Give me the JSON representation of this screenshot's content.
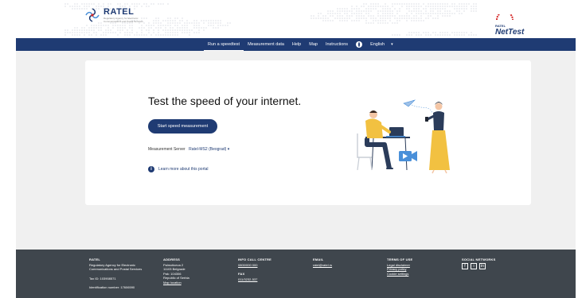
{
  "header": {
    "logo_left": "RATEL",
    "logo_left_sub": "Regulatory Agency for Electronic Communications and Postal Services",
    "logo_right_small": "RATEL",
    "logo_right_big": "NetTest"
  },
  "nav": {
    "items": [
      "Run a speedtest",
      "Measurement data",
      "Help",
      "Map",
      "Instructions"
    ],
    "active_index": 0,
    "language": "English"
  },
  "main": {
    "headline": "Test the speed of your internet.",
    "start_button": "Start speed measurement",
    "server_label": "Measurement Server",
    "server_value": "Ratel-MS2 (Beograd)",
    "learn_more": "Learn more about this portal"
  },
  "footer": {
    "ratel_title": "RATEL",
    "ratel_line1": "Regulatory Agency for Electronic",
    "ratel_line2": "Communications and Postal Services",
    "tax_id": "Tax ID: 103908571",
    "identification": "Identification number: 17606590",
    "address_title": "ADDRESS",
    "address_line1": "Palmoticeva 2",
    "address_line2": "11103 Belgrade",
    "address_line3": "Pak: 104306",
    "address_line4": "Republic of Serbia",
    "address_link": "Map location",
    "info_title": "INFO CALL CENTRE",
    "info_phone": "0800/000 000",
    "fax_title": "FAX",
    "fax_value": "011/3232-537",
    "email_title": "EMAIL",
    "email_value": "ratel@ratel.rs",
    "terms_title": "TERMS OF USE",
    "terms_links": [
      "Legal disclaimer",
      "Privacy policy",
      "Cookie settings"
    ],
    "social_title": "SOCIAL NETWORKS",
    "social_icons": [
      "f",
      "○",
      "in"
    ]
  },
  "colors": {
    "brand_navy": "#1f3b73",
    "footer_bg": "#3f464d",
    "page_bg": "#f0f0f0",
    "illustration_yellow": "#f2c141",
    "illustration_blue": "#4a90d9"
  }
}
